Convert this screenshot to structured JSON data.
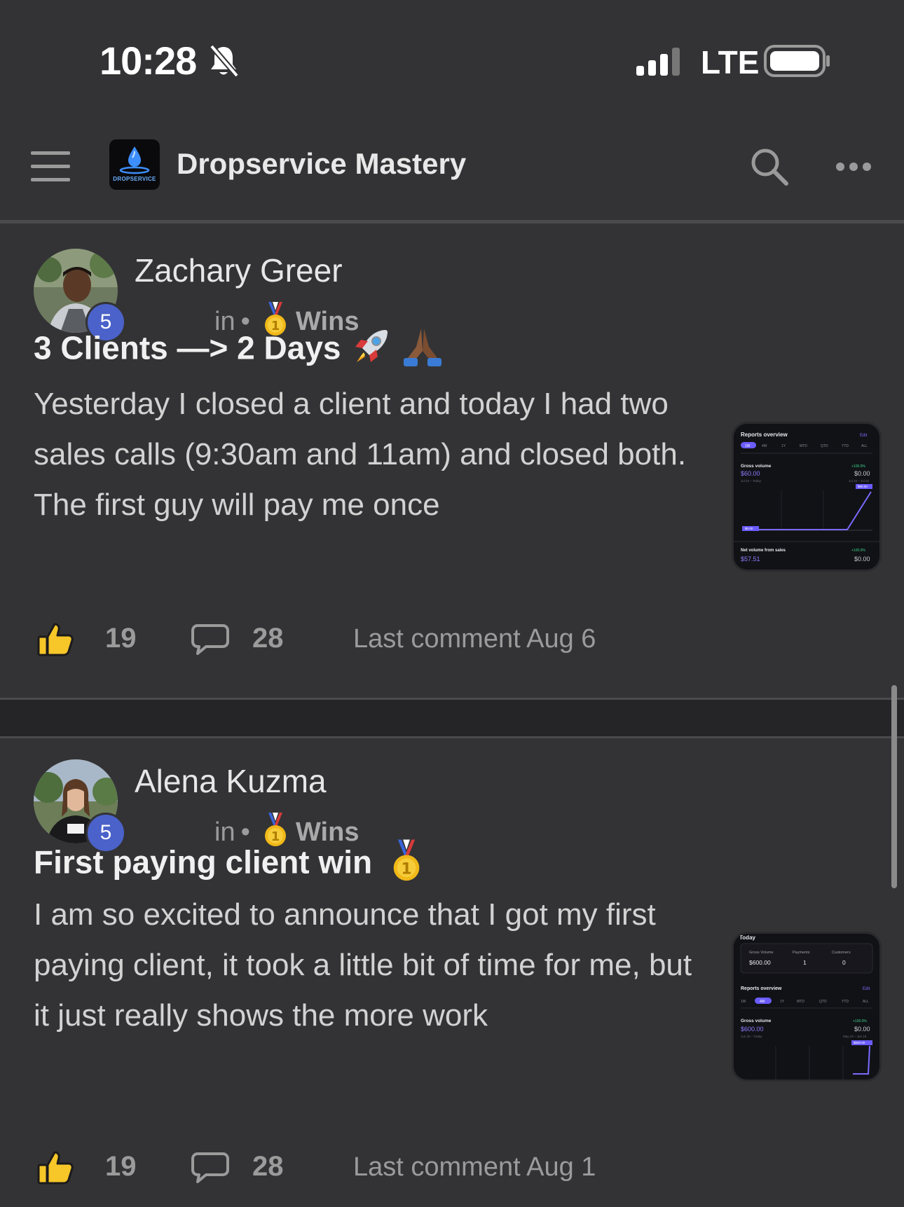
{
  "status_bar": {
    "time": "10:28",
    "network": "LTE"
  },
  "header": {
    "app_title": "Dropservice Mastery",
    "logo_text": "DROPSERVICE"
  },
  "posts": [
    {
      "author": "Zachary Greer",
      "level": "5",
      "in_label": "in",
      "category": "Wins",
      "title": "3 Clients —> 2 Days",
      "body": "Yesterday I closed a client and today I had two sales calls (9:30am and 11am) and closed both. The first guy will pay me once",
      "likes": "19",
      "comments": "28",
      "last_comment": "Last comment Aug 6",
      "thumbnail": {
        "heading": "Reports overview",
        "edit": "Edit",
        "tabs": [
          "1W",
          "4W",
          "1Y",
          "MTD",
          "QTD",
          "YTD",
          "ALL"
        ],
        "gross_label": "Gross volume",
        "gross_value": "$60.00",
        "gross_range": "Jul 23 – Today",
        "gross_change": "+100.0%",
        "gross_prev": "$0.00",
        "prev_range": "Jul 16 – Jul 22",
        "bar_top": "$60.00",
        "bar_bottom": "$0.00",
        "net_label": "Net volume from sales",
        "net_value": "$57.51",
        "net_change": "+100.0%",
        "net_prev": "$0.00"
      }
    },
    {
      "author": "Alena Kuzma",
      "level": "5",
      "in_label": "in",
      "category": "Wins",
      "title": "First paying client win",
      "body": "I am so excited to announce that I got my first paying client, it took a little bit of time for me, but it just really shows the more work",
      "likes": "19",
      "comments": "28",
      "last_comment": "Last comment Aug 1",
      "thumbnail": {
        "today": "Today",
        "col1": "Gross Volume",
        "col2": "Payments",
        "col3": "Customers",
        "val1": "$600.00",
        "val2": "1",
        "val3": "0",
        "heading": "Reports overview",
        "edit": "Edit",
        "tabs": [
          "1W",
          "4W",
          "1Y",
          "MTD",
          "QTD",
          "YTD",
          "ALL"
        ],
        "gross_label": "Gross volume",
        "gross_value": "$600.00",
        "gross_range": "Jun 20 – Today",
        "gross_change": "+100.0%",
        "gross_prev": "$0.00",
        "prev_range": "May 23 – Jun 19",
        "bar_top": "$600.00"
      }
    }
  ],
  "colors": {
    "background": "#333335",
    "level_badge": "#4a62c9",
    "accent_purple": "#7a6bff",
    "positive_green": "#3dd68c",
    "muted_text": "#9b9b9b"
  }
}
